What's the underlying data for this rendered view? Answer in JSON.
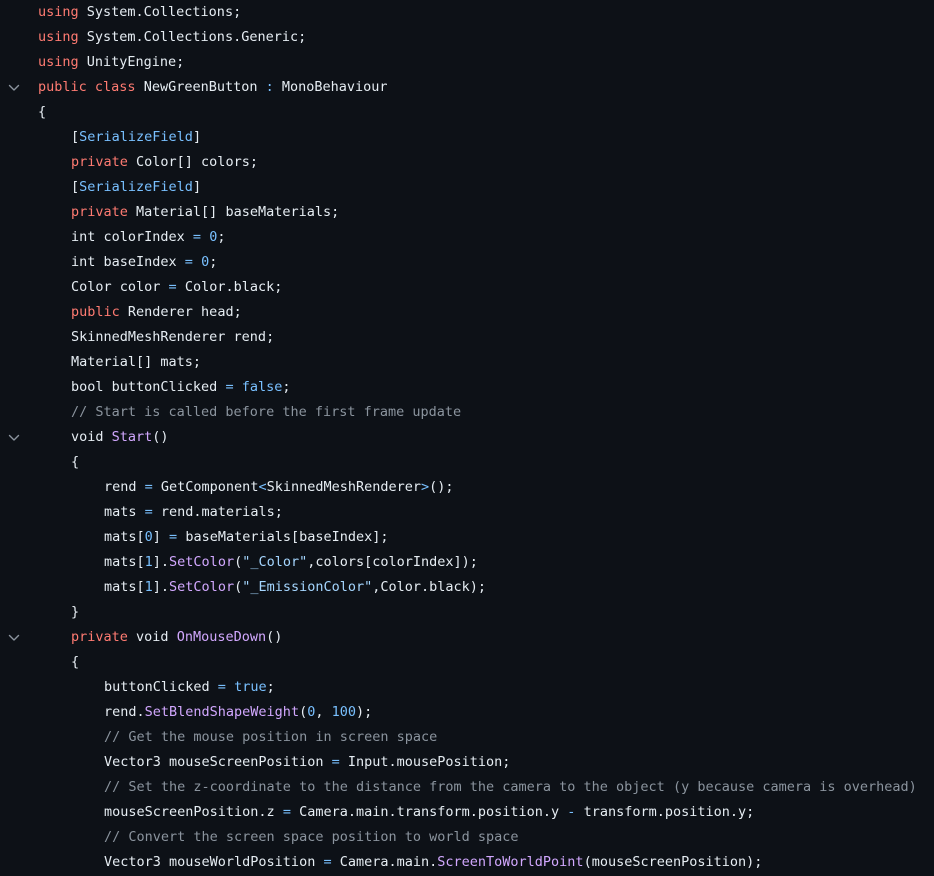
{
  "theme": {
    "background": "#0d1117",
    "keyword": "#ff7b72",
    "type": "#79c0ff",
    "function": "#d2a8ff",
    "string": "#a5d6ff",
    "comment": "#8b949e",
    "number": "#79c0ff",
    "plain": "#e6edf3"
  },
  "fold_icon": "chevron-down-icon",
  "lines": [
    {
      "indent": 0,
      "fold": false,
      "tokens": [
        [
          "kw",
          "using"
        ],
        [
          "pl",
          " System.Collections;"
        ]
      ]
    },
    {
      "indent": 0,
      "fold": false,
      "tokens": [
        [
          "kw",
          "using"
        ],
        [
          "pl",
          " System.Collections.Generic;"
        ]
      ]
    },
    {
      "indent": 0,
      "fold": false,
      "tokens": [
        [
          "kw",
          "using"
        ],
        [
          "pl",
          " UnityEngine;"
        ]
      ]
    },
    {
      "indent": 0,
      "fold": true,
      "tokens": [
        [
          "kw",
          "public"
        ],
        [
          "pl",
          " "
        ],
        [
          "kw",
          "class"
        ],
        [
          "pl",
          " NewGreenButton "
        ],
        [
          "ty",
          ":"
        ],
        [
          "pl",
          " MonoBehaviour"
        ]
      ]
    },
    {
      "indent": 0,
      "fold": false,
      "tokens": [
        [
          "pl",
          "{"
        ]
      ]
    },
    {
      "indent": 1,
      "fold": false,
      "tokens": [
        [
          "pl",
          "["
        ],
        [
          "ty",
          "SerializeField"
        ],
        [
          "pl",
          "]"
        ]
      ]
    },
    {
      "indent": 1,
      "fold": false,
      "tokens": [
        [
          "kw",
          "private"
        ],
        [
          "pl",
          " Color[] colors;"
        ]
      ]
    },
    {
      "indent": 1,
      "fold": false,
      "tokens": [
        [
          "pl",
          "["
        ],
        [
          "ty",
          "SerializeField"
        ],
        [
          "pl",
          "]"
        ]
      ]
    },
    {
      "indent": 1,
      "fold": false,
      "tokens": [
        [
          "kw",
          "private"
        ],
        [
          "pl",
          " Material[] baseMaterials;"
        ]
      ]
    },
    {
      "indent": 1,
      "fold": false,
      "tokens": [
        [
          "pl",
          "int colorIndex "
        ],
        [
          "ty",
          "="
        ],
        [
          "pl",
          " "
        ],
        [
          "nu",
          "0"
        ],
        [
          "pl",
          ";"
        ]
      ]
    },
    {
      "indent": 1,
      "fold": false,
      "tokens": [
        [
          "pl",
          "int baseIndex "
        ],
        [
          "ty",
          "="
        ],
        [
          "pl",
          " "
        ],
        [
          "nu",
          "0"
        ],
        [
          "pl",
          ";"
        ]
      ]
    },
    {
      "indent": 1,
      "fold": false,
      "tokens": [
        [
          "pl",
          "Color color "
        ],
        [
          "ty",
          "="
        ],
        [
          "pl",
          " Color.black;"
        ]
      ]
    },
    {
      "indent": 1,
      "fold": false,
      "tokens": [
        [
          "kw",
          "public"
        ],
        [
          "pl",
          " Renderer head;"
        ]
      ]
    },
    {
      "indent": 1,
      "fold": false,
      "tokens": [
        [
          "pl",
          "SkinnedMeshRenderer rend;"
        ]
      ]
    },
    {
      "indent": 1,
      "fold": false,
      "tokens": [
        [
          "pl",
          "Material[] mats;"
        ]
      ]
    },
    {
      "indent": 1,
      "fold": false,
      "tokens": [
        [
          "pl",
          "bool buttonClicked "
        ],
        [
          "ty",
          "="
        ],
        [
          "pl",
          " "
        ],
        [
          "nu",
          "false"
        ],
        [
          "pl",
          ";"
        ]
      ]
    },
    {
      "indent": 1,
      "fold": false,
      "tokens": [
        [
          "cm",
          "// Start is called before the first frame update"
        ]
      ]
    },
    {
      "indent": 1,
      "fold": true,
      "tokens": [
        [
          "pl",
          "void "
        ],
        [
          "fn",
          "Start"
        ],
        [
          "pl",
          "()"
        ]
      ]
    },
    {
      "indent": 1,
      "fold": false,
      "tokens": [
        [
          "pl",
          "{"
        ]
      ]
    },
    {
      "indent": 2,
      "fold": false,
      "tokens": [
        [
          "pl",
          "rend "
        ],
        [
          "ty",
          "="
        ],
        [
          "pl",
          " GetComponent"
        ],
        [
          "ty",
          "<"
        ],
        [
          "pl",
          "SkinnedMeshRenderer"
        ],
        [
          "ty",
          ">"
        ],
        [
          "pl",
          "();"
        ]
      ]
    },
    {
      "indent": 2,
      "fold": false,
      "tokens": [
        [
          "pl",
          "mats "
        ],
        [
          "ty",
          "="
        ],
        [
          "pl",
          " rend.materials;"
        ]
      ]
    },
    {
      "indent": 2,
      "fold": false,
      "tokens": [
        [
          "pl",
          "mats["
        ],
        [
          "nu",
          "0"
        ],
        [
          "pl",
          "] "
        ],
        [
          "ty",
          "="
        ],
        [
          "pl",
          " baseMaterials[baseIndex];"
        ]
      ]
    },
    {
      "indent": 2,
      "fold": false,
      "tokens": [
        [
          "pl",
          "mats["
        ],
        [
          "nu",
          "1"
        ],
        [
          "pl",
          "]."
        ],
        [
          "fn",
          "SetColor"
        ],
        [
          "pl",
          "("
        ],
        [
          "st",
          "\"_Color\""
        ],
        [
          "pl",
          ",colors[colorIndex]);"
        ]
      ]
    },
    {
      "indent": 2,
      "fold": false,
      "tokens": [
        [
          "pl",
          "mats["
        ],
        [
          "nu",
          "1"
        ],
        [
          "pl",
          "]."
        ],
        [
          "fn",
          "SetColor"
        ],
        [
          "pl",
          "("
        ],
        [
          "st",
          "\"_EmissionColor\""
        ],
        [
          "pl",
          ",Color.black);"
        ]
      ]
    },
    {
      "indent": 1,
      "fold": false,
      "tokens": [
        [
          "pl",
          "}"
        ]
      ]
    },
    {
      "indent": 1,
      "fold": true,
      "tokens": [
        [
          "kw",
          "private"
        ],
        [
          "pl",
          " void "
        ],
        [
          "fn",
          "OnMouseDown"
        ],
        [
          "pl",
          "()"
        ]
      ]
    },
    {
      "indent": 1,
      "fold": false,
      "tokens": [
        [
          "pl",
          "{"
        ]
      ]
    },
    {
      "indent": 2,
      "fold": false,
      "tokens": [
        [
          "pl",
          "buttonClicked "
        ],
        [
          "ty",
          "="
        ],
        [
          "pl",
          " "
        ],
        [
          "nu",
          "true"
        ],
        [
          "pl",
          ";"
        ]
      ]
    },
    {
      "indent": 2,
      "fold": false,
      "tokens": [
        [
          "pl",
          "rend."
        ],
        [
          "fn",
          "SetBlendShapeWeight"
        ],
        [
          "pl",
          "("
        ],
        [
          "nu",
          "0"
        ],
        [
          "pl",
          ", "
        ],
        [
          "nu",
          "100"
        ],
        [
          "pl",
          ");"
        ]
      ]
    },
    {
      "indent": 2,
      "fold": false,
      "tokens": [
        [
          "cm",
          "// Get the mouse position in screen space"
        ]
      ]
    },
    {
      "indent": 2,
      "fold": false,
      "tokens": [
        [
          "pl",
          "Vector3 mouseScreenPosition "
        ],
        [
          "ty",
          "="
        ],
        [
          "pl",
          " Input.mousePosition;"
        ]
      ]
    },
    {
      "indent": 2,
      "fold": false,
      "tokens": [
        [
          "cm",
          "// Set the z-coordinate to the distance from the camera to the object (y because camera is overhead)"
        ]
      ]
    },
    {
      "indent": 2,
      "fold": false,
      "tokens": [
        [
          "pl",
          "mouseScreenPosition.z "
        ],
        [
          "ty",
          "="
        ],
        [
          "pl",
          " Camera.main.transform.position.y "
        ],
        [
          "ty",
          "-"
        ],
        [
          "pl",
          " transform.position.y;"
        ]
      ]
    },
    {
      "indent": 2,
      "fold": false,
      "tokens": [
        [
          "cm",
          "// Convert the screen space position to world space"
        ]
      ]
    },
    {
      "indent": 2,
      "fold": false,
      "tokens": [
        [
          "pl",
          "Vector3 mouseWorldPosition "
        ],
        [
          "ty",
          "="
        ],
        [
          "pl",
          " Camera.main."
        ],
        [
          "fn",
          "ScreenToWorldPoint"
        ],
        [
          "pl",
          "(mouseScreenPosition);"
        ]
      ]
    }
  ]
}
